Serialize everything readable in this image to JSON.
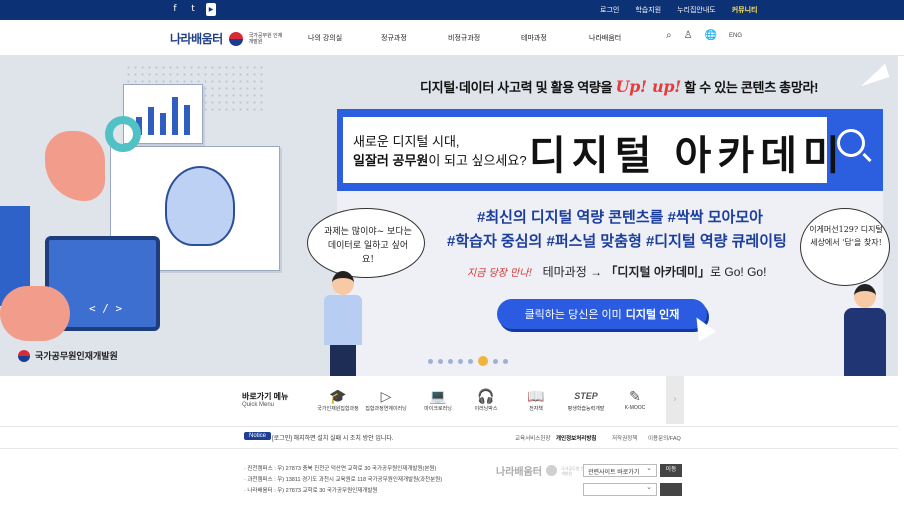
{
  "topbar": {
    "social": [
      "f",
      "t",
      "▶"
    ],
    "links": [
      {
        "label": "로그인",
        "highlight": false
      },
      {
        "label": "학습지원",
        "highlight": false
      },
      {
        "label": "누리집안내도",
        "highlight": false
      },
      {
        "label": "커뮤니티",
        "highlight": true
      }
    ],
    "bg_color": "#0d3175"
  },
  "nav": {
    "brand": "나라배움터",
    "org": "국가공무원 인재개발원",
    "menu": [
      "나의 강의실",
      "정규과정",
      "비정규과정",
      "테마과정",
      "나라배움터"
    ],
    "icons": [
      "search-icon",
      "user-icon",
      "globe-icon"
    ],
    "lang": "ENG"
  },
  "hero": {
    "headline_pre": "디지털·데이터 사고력 및 활용 역량을 ",
    "headline_up": "Up! up!",
    "headline_post": " 할 수 있는 콘텐츠 총망라!",
    "banner_small1": "새로운 디지털 시대,",
    "banner_small2_bold": "일잘러 공무원",
    "banner_small2_rest": "이 되고 싶으세요?",
    "banner_big": "디지털 아카데미",
    "hash1": "#최신의 디지털 역량 콘텐츠를 #싹싹 모아모아",
    "hash2": "#학습자 중심의 #퍼스널 맞춤형 #디지털 역량 큐레이팅",
    "arrow_badge": "지금 당장 만나!",
    "arrow_text_pre": "테마과정 → ",
    "arrow_text_bold": "「디지털 아카데미」",
    "arrow_text_post": "로 Go! Go!",
    "cta_pre": "클릭하는 당신은 이미",
    "cta_bold": "디지털 인재",
    "bubble_left": "과제는 많이야~ 보다는 데이터로 일하고 싶어요!",
    "bubble_right": "이게머선129? 디지털 세상에서 '답'을 찾자!",
    "footer_org": "국가공무원인재개발원",
    "code": "< / >",
    "accent_color": "#2c5ee0"
  },
  "quick": {
    "title": "바로가기 메뉴",
    "subtitle": "Quick Menu",
    "items": [
      {
        "label": "국가인재원집합과정",
        "icon": "graduation-cap-icon",
        "glyph": "🎓"
      },
      {
        "label": "집합과정연계이러닝",
        "icon": "video-play-icon",
        "glyph": "▷"
      },
      {
        "label": "마이크로러닝",
        "icon": "laptop-icon",
        "glyph": "💻"
      },
      {
        "label": "이러닝박스",
        "icon": "headset-icon",
        "glyph": "🎧"
      },
      {
        "label": "전자책",
        "icon": "book-icon",
        "glyph": "📖"
      },
      {
        "label": "평생학습능력개발",
        "icon": "step-logo-icon",
        "glyph": "STEP"
      },
      {
        "label": "K-MOOC",
        "icon": "kmooc-icon",
        "glyph": "✎"
      }
    ],
    "next": "›"
  },
  "notice": {
    "badge": "Notice",
    "text": "[로그인] 해지하면 설치 실패 시 조치 방안 입니다.",
    "links": [
      {
        "label": "교육서비스헌장",
        "bold": false
      },
      {
        "label": "개인정보처리방침",
        "bold": true
      },
      {
        "label": "저작권정책",
        "bold": false
      },
      {
        "label": "이용문의/FAQ",
        "bold": false
      }
    ]
  },
  "footer": {
    "address1": "· 진천캠퍼스 : 우) 27873 충북 진천군 덕산면 교학로 30 국가공무원인재개발원(본원)",
    "address2": "· 과천캠퍼스 : 우) 13811 경기도 과천시 교육원로 118 국가공무원인재개발원(과천분원)",
    "address3": "· 나라배움터 : 우) 27873 교학로 30 국가공무원인재개발원",
    "brand": "나라배움터",
    "org": "국가공무원 인재개발원",
    "select_label": "관련사이트 바로가기",
    "go_label": "이동"
  }
}
